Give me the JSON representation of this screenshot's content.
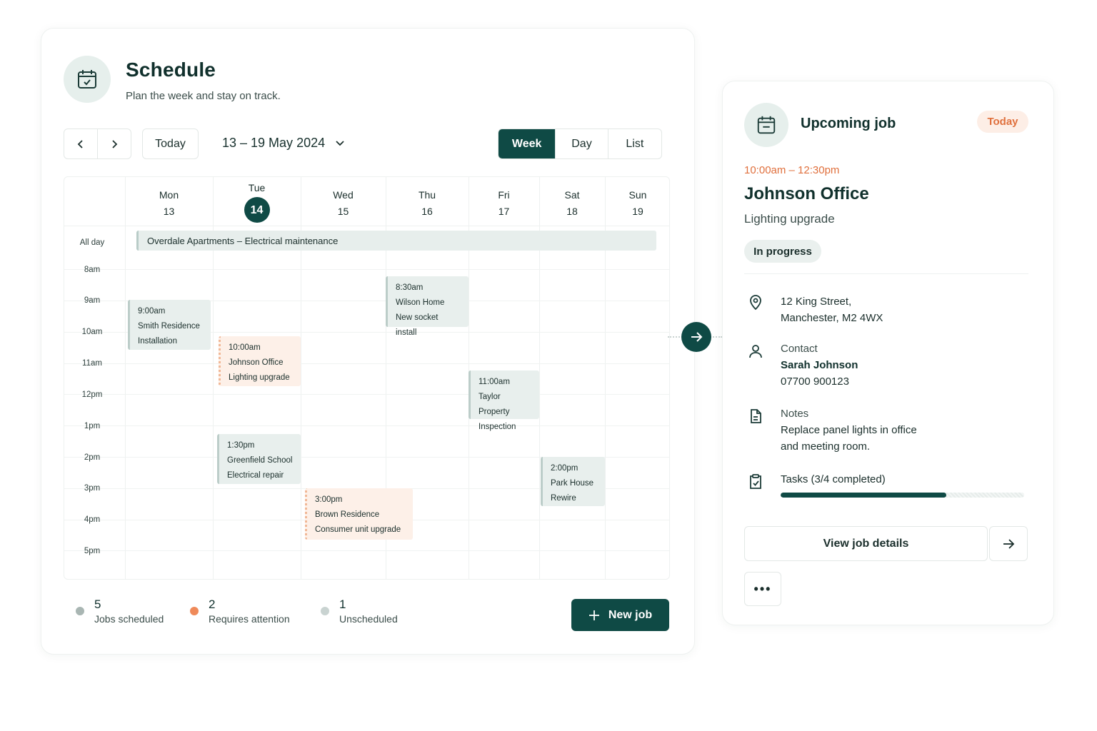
{
  "schedule": {
    "title": "Schedule",
    "subtitle": "Plan the week and stay on track.",
    "icon": "calendar-icon",
    "today_button": "Today",
    "date_range": "13 – 19 May 2024",
    "views": [
      "Week",
      "Day",
      "List"
    ],
    "active_view": "Week",
    "days": [
      {
        "name": "Mon",
        "num": "13"
      },
      {
        "name": "Tue",
        "num": "14",
        "today": true
      },
      {
        "name": "Wed",
        "num": "15"
      },
      {
        "name": "Thu",
        "num": "16"
      },
      {
        "name": "Fri",
        "num": "17"
      },
      {
        "name": "Sat",
        "num": "18"
      },
      {
        "name": "Sun",
        "num": "19"
      }
    ],
    "all_day_label": "All day",
    "times": [
      "8am",
      "9am",
      "10am",
      "11am",
      "12pm",
      "1pm",
      "2pm",
      "3pm",
      "4pm",
      "5pm"
    ],
    "all_day_event": "Overdale Apartments – Electrical maintenance",
    "events": [
      {
        "time": "9:00am",
        "place": "Smith Residence",
        "task": "Installation",
        "tone": "neutral"
      },
      {
        "time": "10:00am",
        "place": "Johnson Office",
        "task": "Lighting upgrade",
        "tone": "warn"
      },
      {
        "time": "8:30am",
        "place": "Wilson Home",
        "task": "New socket install",
        "tone": "neutral"
      },
      {
        "time": "11:00am",
        "place": "Taylor Property",
        "task": "Inspection",
        "tone": "neutral"
      },
      {
        "time": "1:30pm",
        "place": "Greenfield School",
        "task": "Electrical repair",
        "tone": "neutral"
      },
      {
        "time": "2:00pm",
        "place": "Park House",
        "task": "Rewire",
        "tone": "neutral"
      },
      {
        "time": "3:00pm",
        "place": "Brown Residence",
        "task": "Consumer unit upgrade",
        "tone": "warn"
      }
    ],
    "stats": [
      {
        "count": "5",
        "label": "Jobs scheduled",
        "color": "#a9b6b3"
      },
      {
        "count": "2",
        "label": "Requires attention",
        "color": "#ef8a5a"
      },
      {
        "count": "1",
        "label": "Unscheduled",
        "color": "#c9d3d1"
      }
    ],
    "new_job_label": "New job"
  },
  "job": {
    "heading": "Upcoming job",
    "badge": "Today",
    "time": "10:00am – 12:30pm",
    "title": "Johnson Office",
    "subtitle": "Lighting upgrade",
    "status": "In progress",
    "address_line1": "12 King Street,",
    "address_line2": "Manchester, M2 4WX",
    "contact_label": "Contact",
    "contact_name": "Sarah Johnson",
    "contact_phone": "07700 900123",
    "notes_label": "Notes",
    "notes_line1": "Replace panel lights in office",
    "notes_line2": "and meeting room.",
    "tasks_label": "Tasks (3/4 completed)",
    "tasks_progress": 0.68,
    "view_details_label": "View job details",
    "more_label": "•••"
  },
  "colors": {
    "accent": "#0f4a45",
    "attention": "#e0703d"
  }
}
